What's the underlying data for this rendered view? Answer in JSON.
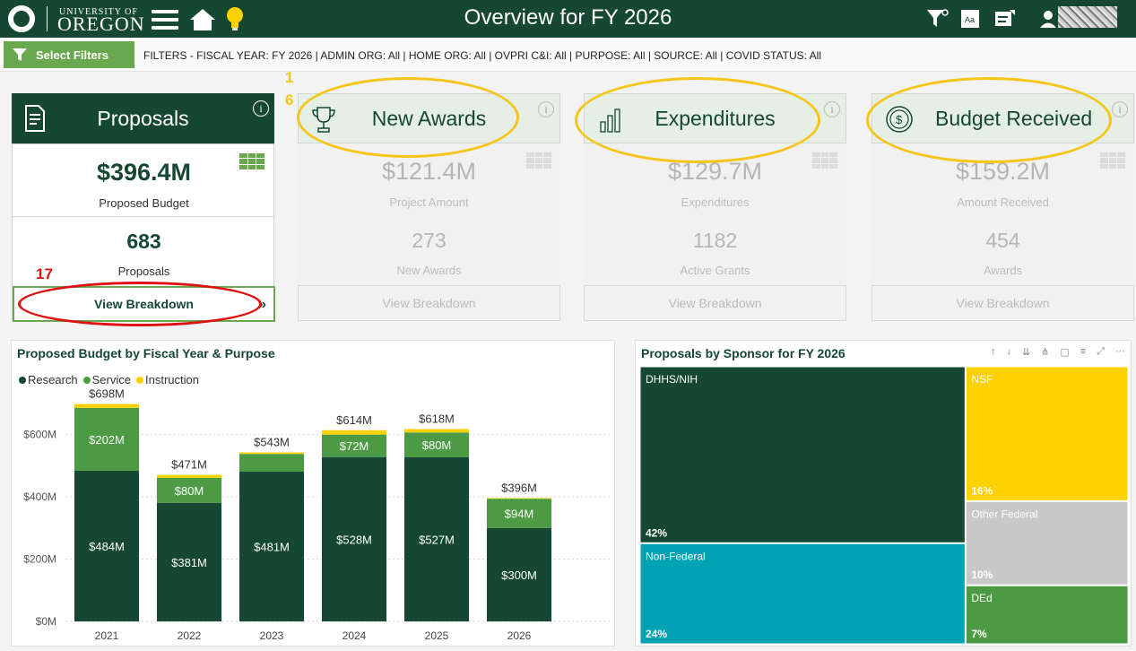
{
  "header": {
    "university_small": "UNIVERSITY OF",
    "university_big": "OREGON",
    "title": "Overview for FY 2026"
  },
  "filters": {
    "button_label": "Select Filters",
    "summary": "FILTERS - FISCAL YEAR: FY 2026 | ADMIN ORG: All | HOME ORG: All | OVPRI C&I: All | PURPOSE: All | SOURCE: All | COVID STATUS: All"
  },
  "cards": {
    "proposals": {
      "title": "Proposals",
      "value1": "$396.4M",
      "label1": "Proposed Budget",
      "value2": "683",
      "label2": "Proposals",
      "button": "View Breakdown"
    },
    "awards": {
      "title": "New Awards",
      "value1": "$121.4M",
      "label1": "Project Amount",
      "value2": "273",
      "label2": "New Awards",
      "button": "View Breakdown"
    },
    "expenditures": {
      "title": "Expenditures",
      "value1": "$129.7M",
      "label1": "Expenditures",
      "value2": "1182",
      "label2": "Active Grants",
      "button": "View Breakdown"
    },
    "budget": {
      "title": "Budget Received",
      "value1": "$159.2M",
      "label1": "Amount Received",
      "value2": "454",
      "label2": "Awards",
      "button": "View Breakdown"
    }
  },
  "annotations": {
    "num1_top": "1",
    "num1_bottom": "6",
    "num17": "17"
  },
  "colors": {
    "green_dark": "#154733",
    "green_mid": "#4c9a43",
    "yellow": "#fed100",
    "teal": "#00a3b4",
    "gray": "#c8c8c8",
    "light_green": "#6aa84f"
  },
  "chart_data": [
    {
      "type": "bar",
      "title": "Proposed Budget by Fiscal Year & Purpose",
      "stacked": true,
      "categories": [
        "2021",
        "2022",
        "2023",
        "2024",
        "2025",
        "2026"
      ],
      "series": [
        {
          "name": "Research",
          "values": [
            484,
            381,
            481,
            528,
            527,
            300
          ],
          "labels": [
            "$484M",
            "$381M",
            "$481M",
            "$528M",
            "$527M",
            "$300M"
          ]
        },
        {
          "name": "Service",
          "values": [
            202,
            80,
            57,
            72,
            80,
            94
          ],
          "labels": [
            "$202M",
            "$80M",
            "",
            "$72M",
            "$80M",
            "$94M"
          ]
        },
        {
          "name": "Instruction",
          "values": [
            12,
            10,
            5,
            14,
            11,
            2
          ],
          "labels": [
            "",
            "",
            "",
            "",
            "",
            ""
          ]
        }
      ],
      "totals": [
        "$698M",
        "$471M",
        "$543M",
        "$614M",
        "$618M",
        "$396M"
      ],
      "yticks": [
        "$0M",
        "$200M",
        "$400M",
        "$600M"
      ],
      "ylim": [
        0,
        720
      ],
      "legend": "top-left"
    },
    {
      "type": "treemap",
      "title": "Proposals by Sponsor for FY 2026",
      "items": [
        {
          "name": "DHHS/NIH",
          "pct": "42%",
          "value": 42
        },
        {
          "name": "Non-Federal",
          "pct": "24%",
          "value": 24
        },
        {
          "name": "NSF",
          "pct": "16%",
          "value": 16
        },
        {
          "name": "Other Federal",
          "pct": "10%",
          "value": 10
        },
        {
          "name": "DEd",
          "pct": "7%",
          "value": 7
        }
      ]
    }
  ]
}
